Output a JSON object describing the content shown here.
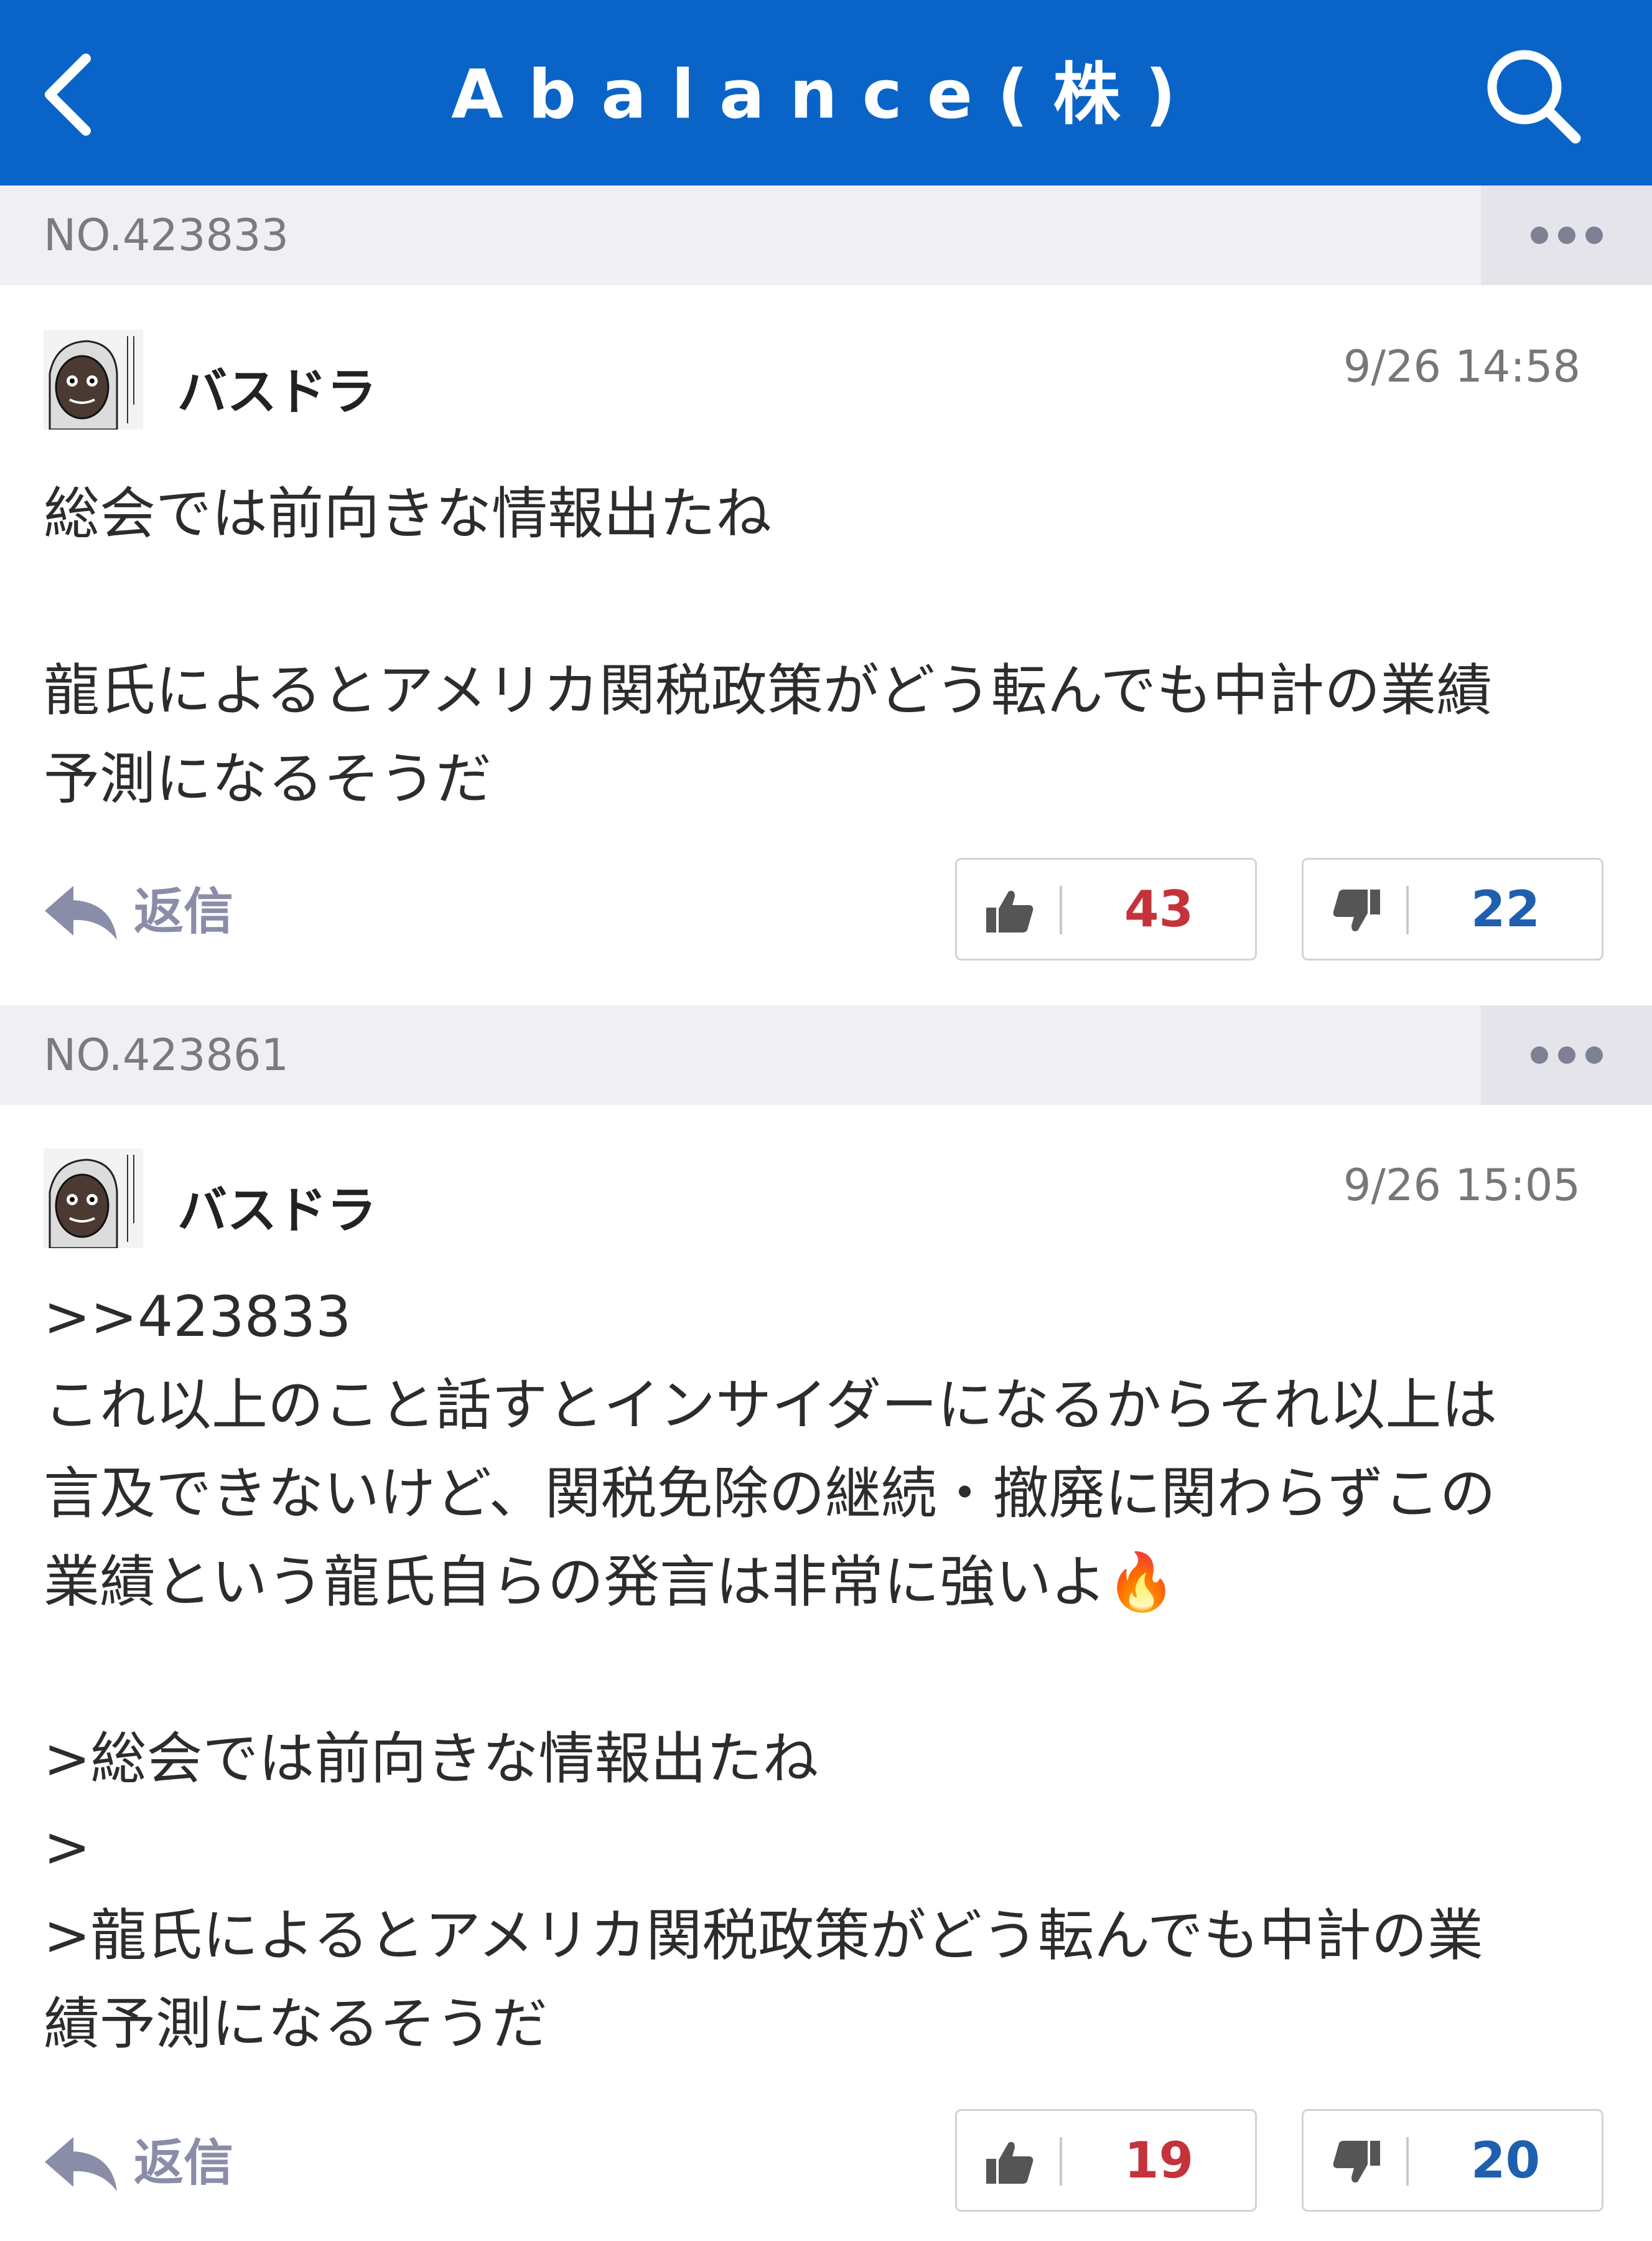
{
  "header": {
    "title": "Abalance(株)",
    "back_icon": "chevron-left-icon",
    "search_icon": "search-icon",
    "background": "#0a64c8"
  },
  "posts": [
    {
      "number": "NO.423833",
      "author": "バスドラ",
      "timestamp": "9/26 14:58",
      "body": "総会では前向きな情報出たね\n\n龍氏によるとアメリカ関税政策がどう転んでも中計の業績\n予測になるそうだ",
      "reply_label": "返信",
      "likes": "43",
      "dislikes": "22"
    },
    {
      "number": "NO.423861",
      "author": "バスドラ",
      "timestamp": "9/26 15:05",
      "body": ">>423833\nこれ以上のこと話すとインサイダーになるからそれ以上は\n言及できないけど、関税免除の継続・撤廃に関わらずこの\n業績という龍氏自らの発言は非常に強いよ🔥\n\n>総会では前向きな情報出たね\n>\n>龍氏によるとアメリカ関税政策がどう転んでも中計の業\n績予測になるそうだ",
      "reply_label": "返信",
      "likes": "19",
      "dislikes": "20"
    }
  ],
  "colors": {
    "like": "#c4333a",
    "dislike": "#1f5fb0",
    "reply": "#8a8da8"
  }
}
